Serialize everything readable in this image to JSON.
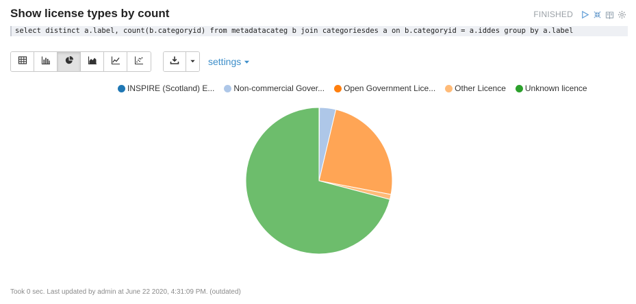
{
  "paragraph": {
    "title": "Show license types by count",
    "status": "FINISHED",
    "query": "select distinct a.label, count(b.categoryid) from metadatacateg b join categoriesdes a on b.categoryid = a.iddes group by a.label",
    "footer": "Took 0 sec. Last updated by admin at June 22 2020, 4:31:09 PM. (outdated)"
  },
  "status_icons": [
    "run-icon",
    "collapse-icon",
    "book-icon",
    "gear-icon"
  ],
  "toolbar": {
    "viz_buttons": [
      {
        "icon": "table-icon",
        "active": false
      },
      {
        "icon": "bar-chart-icon",
        "active": false
      },
      {
        "icon": "pie-chart-icon",
        "active": true
      },
      {
        "icon": "area-chart-icon",
        "active": false
      },
      {
        "icon": "line-chart-icon",
        "active": false
      },
      {
        "icon": "scatter-chart-icon",
        "active": false
      }
    ],
    "download_icon": "download-icon",
    "settings_label": "settings"
  },
  "chart_data": {
    "type": "pie",
    "legend_position": "top",
    "series": [
      {
        "label": "INSPIRE (Scotland) E...",
        "value": 0.1,
        "color": "#1f77b4"
      },
      {
        "label": "Non-commercial Gover...",
        "value": 3.6,
        "color": "#aec7e8"
      },
      {
        "label": "Open Government Lice...",
        "value": 24.3,
        "color": "#ffa555"
      },
      {
        "label": "Other Licence",
        "value": 1.1,
        "color": "#ffbb78"
      },
      {
        "label": "Unknown licence",
        "value": 70.9,
        "color": "#6dbd6c"
      }
    ],
    "legend_colors": [
      "#1f77b4",
      "#aec7e8",
      "#ff7f0e",
      "#ffbb78",
      "#2ca02c"
    ]
  }
}
